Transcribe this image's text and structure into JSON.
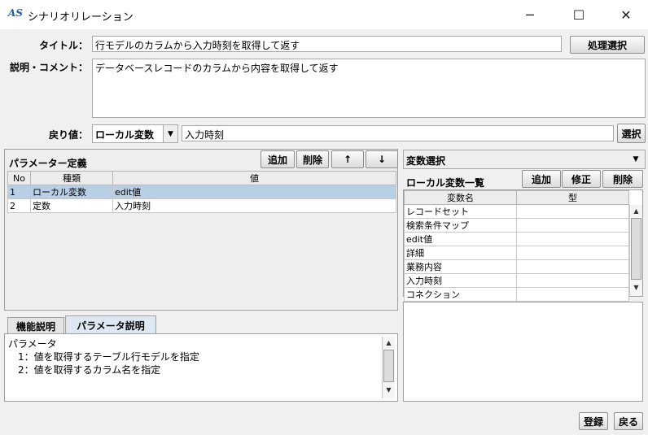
{
  "window": {
    "icon_text": "AS",
    "title": "シナリオリレーション",
    "minimize": "─",
    "maximize": "☐",
    "close": "✕"
  },
  "form": {
    "title_label": "タイトル：",
    "title_value": "行モデルのカラムから入力時刻を取得して返す",
    "process_select_button": "処理選択",
    "comment_label": "説明・コメント：",
    "comment_value": "データベースレコードのカラムから内容を取得して返す",
    "return_label": "戻り値：",
    "return_type": "ローカル変数",
    "return_value": "入力時刻",
    "select_button": "選択"
  },
  "params": {
    "title": "パラメーター定義",
    "add_button": "追加",
    "delete_button": "削除",
    "up_button": "↑",
    "down_button": "↓",
    "columns": [
      "No",
      "種類",
      "値"
    ],
    "rows": [
      {
        "no": "1",
        "type": "ローカル変数",
        "value": "edit値",
        "selected": true
      },
      {
        "no": "2",
        "type": "定数",
        "value": "入力時刻",
        "selected": false
      }
    ]
  },
  "desc_tabs": {
    "tabs": [
      "機能説明",
      "パラメータ説明"
    ],
    "active_tab": 1,
    "lines": [
      "パラメータ",
      "　1：値を取得するテーブル行モデルを指定",
      "　2：値を取得するカラム名を指定"
    ]
  },
  "vars": {
    "selector_value": "変数選択",
    "list_title": "ローカル変数一覧",
    "add_button": "追加",
    "edit_button": "修正",
    "delete_button": "削除",
    "columns": [
      "変数名",
      "型"
    ],
    "rows": [
      "レコードセット",
      "検索条件マップ",
      "edit値",
      "詳細",
      "業務内容",
      "入力時刻",
      "コネクション"
    ]
  },
  "footer": {
    "register_button": "登録",
    "back_button": "戻る"
  }
}
